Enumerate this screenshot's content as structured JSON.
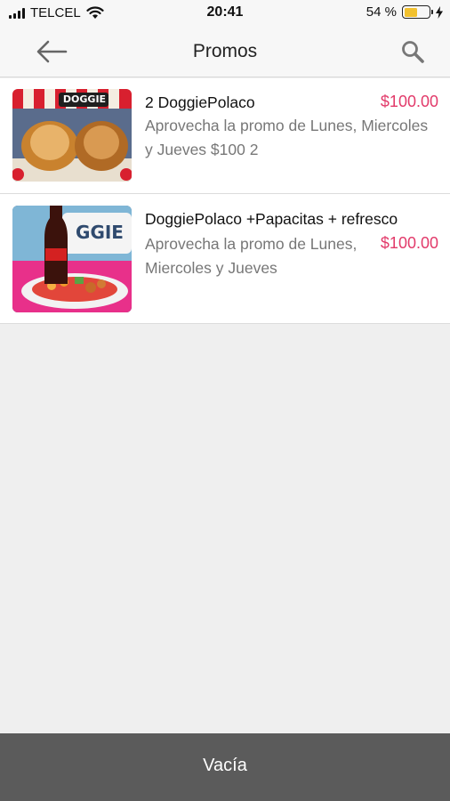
{
  "status_bar": {
    "carrier": "TELCEL",
    "time": "20:41",
    "battery": "54 %",
    "battery_level": 0.54
  },
  "nav": {
    "title": "Promos",
    "back_icon": "back-arrow-icon",
    "search_icon": "search-icon"
  },
  "items": [
    {
      "title": "2 DoggiePolaco",
      "price": "$100.00",
      "description": "Aprovecha la promo de Lunes, Miercoles y Jueves $100 2",
      "thumb_logo": "DOGGIE"
    },
    {
      "title": "DoggiePolaco +Papacitas + refresco",
      "price": "$100.00",
      "description": "Aprovecha la promo de Lunes, Miercoles y Jueves",
      "thumb_logo": "GGIE"
    }
  ],
  "footer": {
    "label": "Vacía"
  },
  "colors": {
    "price": "#e23a6a",
    "footer": "#5b5b5b",
    "battery": "#f2c12e"
  }
}
